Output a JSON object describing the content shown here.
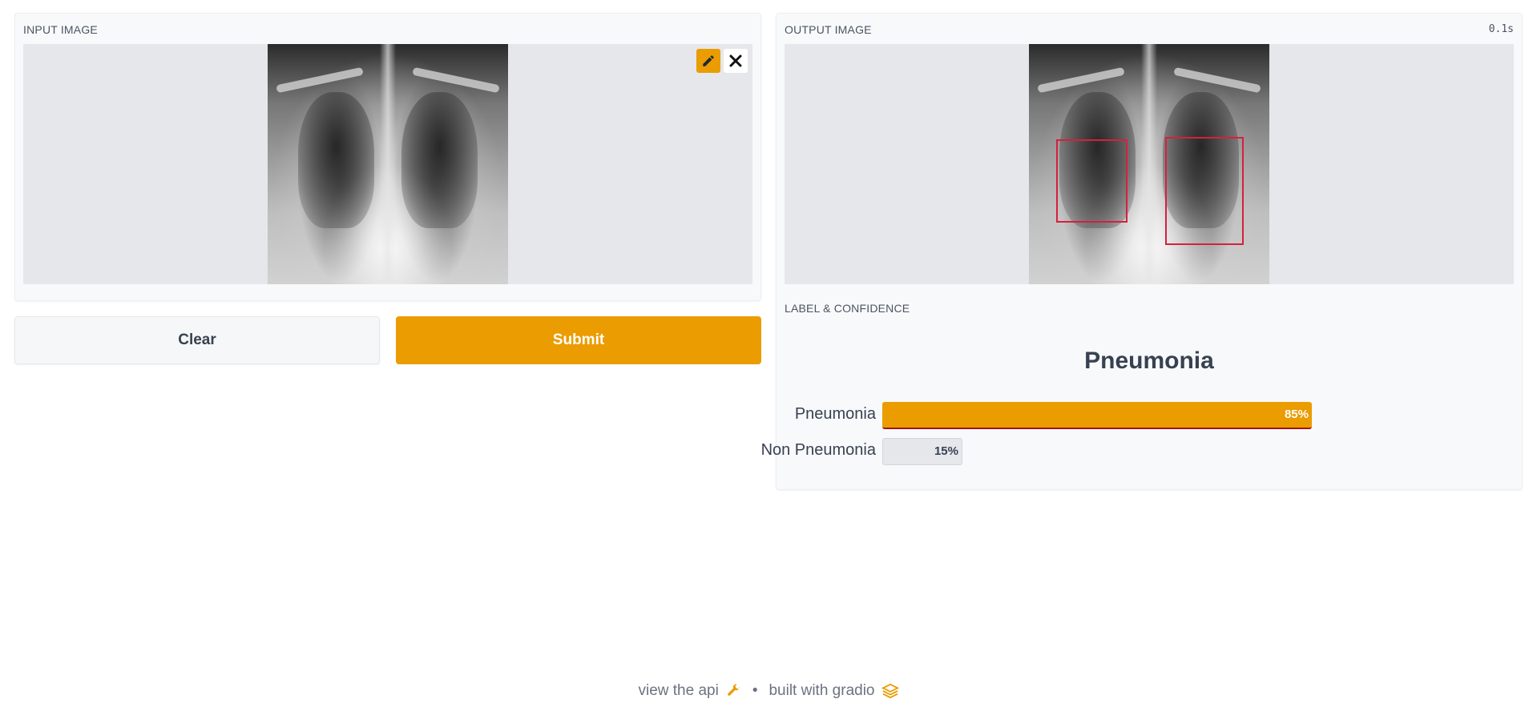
{
  "input_panel": {
    "label": "INPUT IMAGE",
    "edit_icon": "pencil-icon",
    "clear_icon": "close-icon"
  },
  "output_panel": {
    "label": "OUTPUT IMAGE",
    "elapsed": "0.1s"
  },
  "buttons": {
    "clear_label": "Clear",
    "submit_label": "Submit"
  },
  "label_section": {
    "label": "LABEL & CONFIDENCE",
    "prediction": "Pneumonia",
    "confidences": [
      {
        "label": "Pneumonia",
        "percent_text": "85%",
        "value": 0.85
      },
      {
        "label": "Non Pneumonia",
        "percent_text": "15%",
        "value": 0.15
      }
    ]
  },
  "footer": {
    "api_link": "view the api",
    "separator": "•",
    "built_with": "built with gradio",
    "api_icon": "wrench-icon",
    "gradio_icon": "gradio-logo-icon"
  },
  "colors": {
    "accent": "#eb9c00",
    "bbox": "#d4213d",
    "panel_bg": "#f8f9fa",
    "image_bg": "#e5e7eb"
  }
}
